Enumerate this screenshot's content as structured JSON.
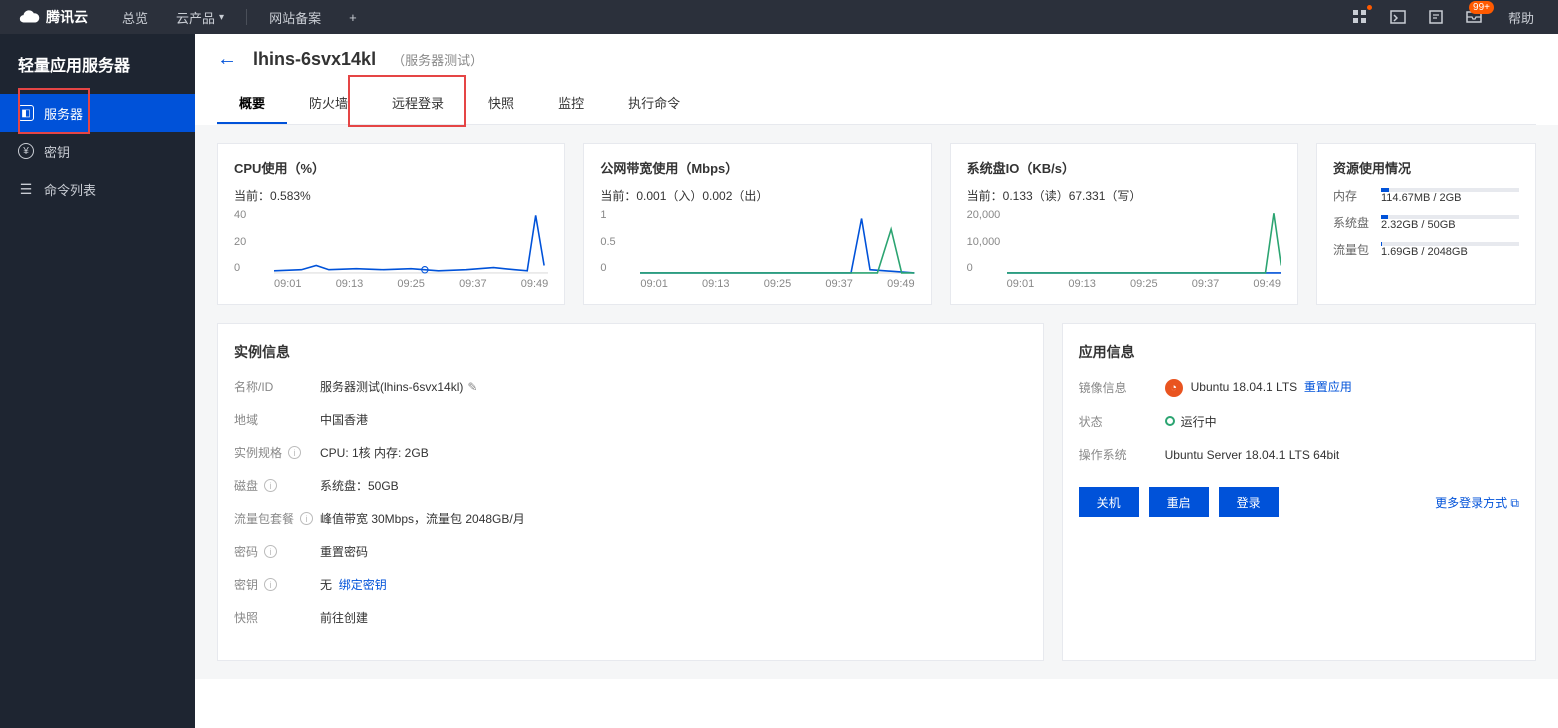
{
  "brand": "腾讯云",
  "topnav": {
    "overview": "总览",
    "products": "云产品",
    "filing": "网站备案",
    "help": "帮助"
  },
  "notif_badge": "99+",
  "sidebar": {
    "title": "轻量应用服务器",
    "server": "服务器",
    "key": "密钥",
    "cmdlist": "命令列表"
  },
  "page": {
    "back": "←",
    "title": "lhins-6svx14kl",
    "subtitle": "（服务器测试）"
  },
  "tabs": {
    "overview": "概要",
    "firewall": "防火墙",
    "remote": "远程登录",
    "snapshot": "快照",
    "monitor": "监控",
    "exec": "执行命令"
  },
  "metrics": {
    "cpu": {
      "title": "CPU使用（%）",
      "cur_label": "当前：",
      "cur": "0.583%"
    },
    "net": {
      "title": "公网带宽使用（Mbps）",
      "cur_label": "当前：",
      "cur": "0.001（入）0.002（出）"
    },
    "disk": {
      "title": "系统盘IO（KB/s）",
      "cur_label": "当前：",
      "cur": "0.133（读）67.331（写）"
    }
  },
  "xticks": [
    "09:01",
    "09:13",
    "09:25",
    "09:37",
    "09:49"
  ],
  "cpu_y": [
    "40",
    "20",
    "0"
  ],
  "net_y": [
    "1",
    "0.5",
    "0"
  ],
  "disk_y": [
    "20,000",
    "10,000",
    "0"
  ],
  "res": {
    "title": "资源使用情况",
    "mem": {
      "lbl": "内存",
      "val": "114.67MB / 2GB",
      "pct": 6
    },
    "sys": {
      "lbl": "系统盘",
      "val": "2.32GB / 50GB",
      "pct": 5
    },
    "pkg": {
      "lbl": "流量包",
      "val": "1.69GB / 2048GB",
      "pct": 1
    }
  },
  "instance": {
    "title": "实例信息",
    "name_k": "名称/ID",
    "name_v": "服务器测试(lhins-6svx14kl)",
    "region_k": "地域",
    "region_v": "中国香港",
    "spec_k": "实例规格",
    "spec_v": "CPU: 1核 内存: 2GB",
    "disk_k": "磁盘",
    "disk_v": "系统盘：50GB",
    "pkg_k": "流量包套餐",
    "pkg_v": "峰值带宽 30Mbps，流量包 2048GB/月",
    "pwd_k": "密码",
    "pwd_link": "重置密码",
    "key_k": "密钥",
    "key_v": "无",
    "key_link": "绑定密钥",
    "snap_k": "快照",
    "snap_link": "前往创建"
  },
  "app": {
    "title": "应用信息",
    "image_k": "镜像信息",
    "image_v": "Ubuntu 18.04.1 LTS",
    "image_link": "重置应用",
    "status_k": "状态",
    "status_v": "运行中",
    "os_k": "操作系统",
    "os_v": "Ubuntu Server 18.04.1 LTS 64bit",
    "btn_off": "关机",
    "btn_restart": "重启",
    "btn_login": "登录",
    "more": "更多登录方式"
  },
  "chart_data": [
    {
      "type": "line",
      "title": "CPU使用（%）",
      "xlabel": "",
      "ylabel": "%",
      "ylim": [
        0,
        40
      ],
      "x": [
        "09:01",
        "09:07",
        "09:13",
        "09:19",
        "09:25",
        "09:31",
        "09:37",
        "09:43",
        "09:49",
        "09:55"
      ],
      "series": [
        {
          "name": "cpu",
          "values": [
            2,
            3,
            5,
            3,
            3,
            2,
            3,
            2,
            4,
            38
          ]
        }
      ]
    },
    {
      "type": "line",
      "title": "公网带宽使用（Mbps）",
      "ylim": [
        0,
        1
      ],
      "x": [
        "09:01",
        "09:07",
        "09:13",
        "09:19",
        "09:25",
        "09:31",
        "09:37",
        "09:43",
        "09:49",
        "09:55"
      ],
      "series": [
        {
          "name": "入",
          "values": [
            0,
            0,
            0,
            0,
            0,
            0,
            0,
            0.9,
            0.02,
            0
          ]
        },
        {
          "name": "出",
          "values": [
            0,
            0,
            0,
            0,
            0,
            0,
            0,
            0,
            0.7,
            0
          ]
        }
      ]
    },
    {
      "type": "line",
      "title": "系统盘IO（KB/s）",
      "ylim": [
        0,
        20000
      ],
      "x": [
        "09:01",
        "09:07",
        "09:13",
        "09:19",
        "09:25",
        "09:31",
        "09:37",
        "09:43",
        "09:49",
        "09:55"
      ],
      "series": [
        {
          "name": "读",
          "values": [
            0,
            0,
            0,
            0,
            0,
            0,
            0,
            0,
            0,
            0.1
          ]
        },
        {
          "name": "写",
          "values": [
            50,
            50,
            50,
            50,
            50,
            50,
            50,
            50,
            50,
            19000
          ]
        }
      ]
    }
  ]
}
